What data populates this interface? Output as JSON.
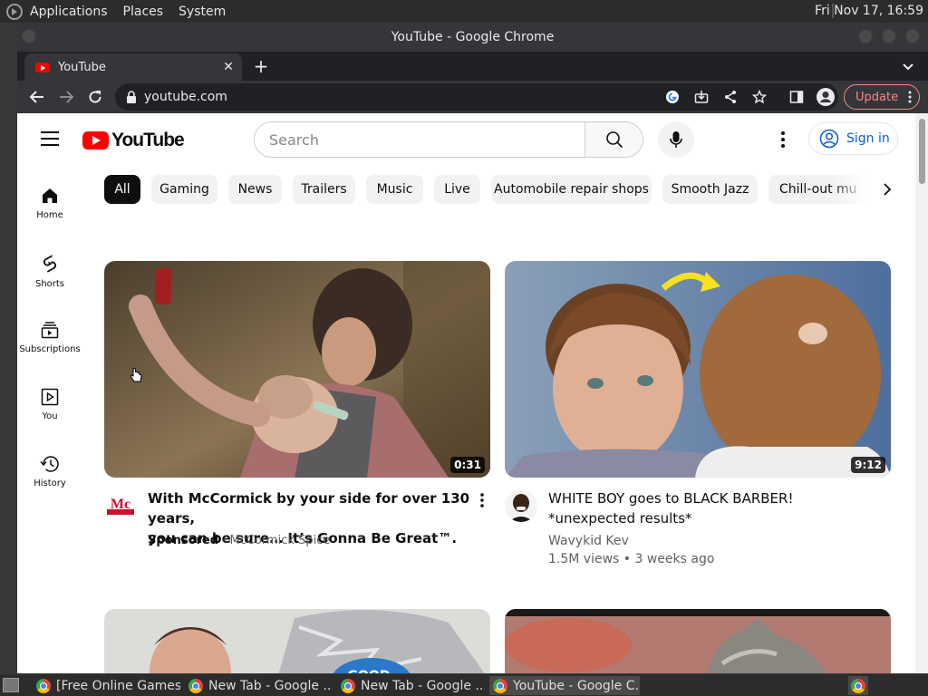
{
  "os": {
    "menus": [
      "Applications",
      "Places",
      "System"
    ],
    "clock": "Fri Nov 17, 16:59"
  },
  "window": {
    "title": "YouTube - Google Chrome"
  },
  "tabs": [
    {
      "label": "YouTube",
      "close": "✕"
    }
  ],
  "toolbar": {
    "new_tab": "+",
    "url": "youtube.com",
    "update_label": "Update"
  },
  "youtube": {
    "logo_text": "YouTube",
    "search_placeholder": "Search",
    "signin_label": "Sign in",
    "chips": [
      "All",
      "Gaming",
      "News",
      "Trailers",
      "Music",
      "Live",
      "Automobile repair shops",
      "Smooth Jazz",
      "Chill-out mu"
    ],
    "guide": [
      {
        "label": "Home",
        "icon": "home-icon"
      },
      {
        "label": "Shorts",
        "icon": "shorts-icon"
      },
      {
        "label": "Subscriptions",
        "icon": "subscriptions-icon"
      },
      {
        "label": "You",
        "icon": "you-icon"
      },
      {
        "label": "History",
        "icon": "history-icon"
      }
    ],
    "videos": [
      {
        "title_line1": "With McCormick by your side for over 130 years,",
        "title_line2": "you can be sure… It’s Gonna Be Great™.",
        "sponsored": "Sponsored",
        "channel": "· McCormick Spice",
        "duration": "0:31"
      },
      {
        "title_line1": "WHITE BOY goes to BLACK BARBER!",
        "title_line2": "*unexpected results*",
        "channel": "Wavykid Kev",
        "stats": "1.5M views • 3 weeks ago",
        "duration": "9:12"
      }
    ]
  },
  "taskbar": {
    "tasks": [
      "[Free Online Games...",
      "New Tab - Google ...",
      "New Tab - Google ...",
      "YouTube - Google C..."
    ]
  },
  "colors": {
    "youtube_red": "#ff0000",
    "link_blue": "#065fd4",
    "update_pink": "#f28b82"
  }
}
